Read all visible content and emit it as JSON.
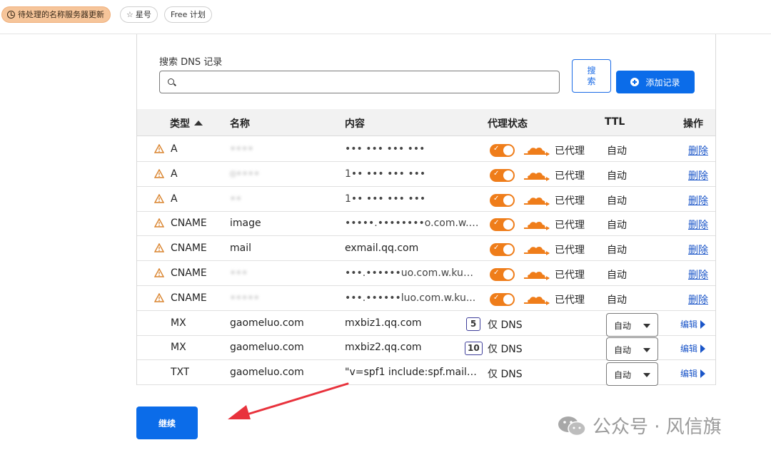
{
  "top": {
    "pending_label": "待处理的名称服务器更新",
    "star_label": "星号",
    "plan_label": "Free 计划"
  },
  "search": {
    "label": "搜索 DNS 记录",
    "value": "",
    "button_label": "搜 索",
    "add_label": "添加记录"
  },
  "table": {
    "headers": {
      "type": "类型",
      "name": "名称",
      "content": "内容",
      "proxy": "代理状态",
      "ttl": "TTL",
      "actions": "操作"
    },
    "rows": [
      {
        "type": "A",
        "name": "••••",
        "content": "••• ••• ••• •••",
        "proxy": "已代理",
        "ttl": "自动",
        "action": "删除",
        "warning": true
      },
      {
        "type": "A",
        "name": "o••••",
        "content": "1•• ••• ••• •••",
        "proxy": "已代理",
        "ttl": "自动",
        "action": "删除",
        "warning": true
      },
      {
        "type": "A",
        "name": "••",
        "content": "1•• ••• ••• •••",
        "proxy": "已代理",
        "ttl": "自动",
        "action": "删除",
        "warning": true
      },
      {
        "type": "CNAME",
        "name": "image",
        "content": "•••••.••••••••o.com.w.k...",
        "proxy": "已代理",
        "ttl": "自动",
        "action": "删除",
        "warning": true
      },
      {
        "type": "CNAME",
        "name": "mail",
        "content": "exmail.qq.com",
        "proxy": "已代理",
        "ttl": "自动",
        "action": "删除",
        "warning": true
      },
      {
        "type": "CNAME",
        "name": "•••",
        "content": "•••.••••••uo.com.w.kunl...",
        "proxy": "已代理",
        "ttl": "自动",
        "action": "删除",
        "warning": true
      },
      {
        "type": "CNAME",
        "name": "•••••",
        "content": "•••.••••••luo.com.w.ku...",
        "proxy": "已代理",
        "ttl": "自动",
        "action": "删除",
        "warning": true
      },
      {
        "type": "MX",
        "name": "gaomeluo.com",
        "content": "mxbiz1.qq.com",
        "priority": "5",
        "proxy": "仅 DNS",
        "ttl": "自动",
        "action": "编辑",
        "warning": false
      },
      {
        "type": "MX",
        "name": "gaomeluo.com",
        "content": "mxbiz2.qq.com",
        "priority": "10",
        "proxy": "仅 DNS",
        "ttl": "自动",
        "action": "编辑",
        "warning": false
      },
      {
        "type": "TXT",
        "name": "gaomeluo.com",
        "content": "\"v=spf1 include:spf.mail....",
        "proxy": "仅 DNS",
        "ttl": "自动",
        "action": "编辑",
        "warning": false
      }
    ]
  },
  "continue_label": "继续",
  "watermark": "公众号 · 风信旗",
  "colors": {
    "primary": "#0b6ce9",
    "proxy_orange": "#ef7d1a",
    "warning": "#d9822b",
    "link": "#1a55c8",
    "arrow": "#e8323c"
  }
}
